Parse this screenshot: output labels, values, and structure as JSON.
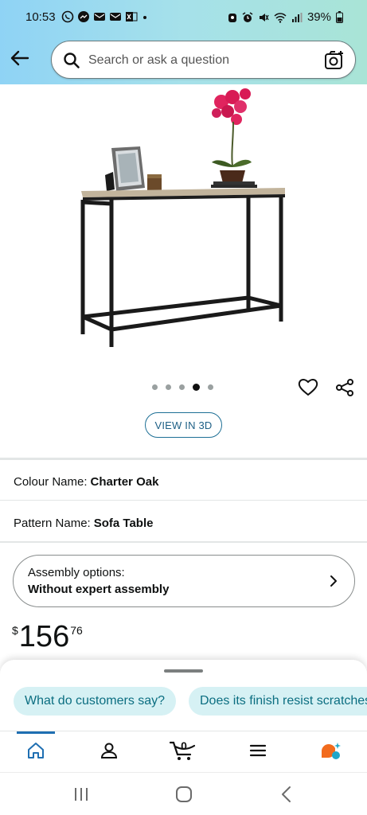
{
  "status_bar": {
    "time": "10:53",
    "battery": "39%",
    "notification_icons": [
      "whatsapp-icon",
      "messenger-icon",
      "mail-icon",
      "mail-icon",
      "excel-icon",
      "dot-icon"
    ],
    "system_icons": [
      "android-icon",
      "alarm-icon",
      "mute-icon",
      "wifi-icon",
      "signal-icon",
      "battery-icon"
    ]
  },
  "search": {
    "placeholder": "Search or ask a question"
  },
  "gallery": {
    "dot_count": 5,
    "active_index": 3,
    "view_3d_label": "VIEW IN 3D"
  },
  "attributes": [
    {
      "label": "Colour Name:",
      "value": "Charter Oak"
    },
    {
      "label": "Pattern Name:",
      "value": "Sofa Table"
    }
  ],
  "assembly": {
    "label": "Assembly options:",
    "value": "Without expert assembly"
  },
  "price": {
    "symbol": "$",
    "whole": "156",
    "fraction": "76"
  },
  "suggestions": [
    "What do customers say?",
    "Does its finish resist scratches?"
  ],
  "bottom_nav": {
    "items": [
      "home-icon",
      "account-icon",
      "cart-icon",
      "menu-icon",
      "rufus-icon"
    ],
    "cart_count": "0",
    "active_index": 0
  },
  "colors": {
    "header_gradient_start": "#8fd3f5",
    "header_gradient_end": "#a9e4d6",
    "link_blue": "#1d5f85",
    "chip_bg": "#d6f1f4",
    "chip_text": "#0b6e81",
    "nav_indicator": "#1f6fb2"
  }
}
